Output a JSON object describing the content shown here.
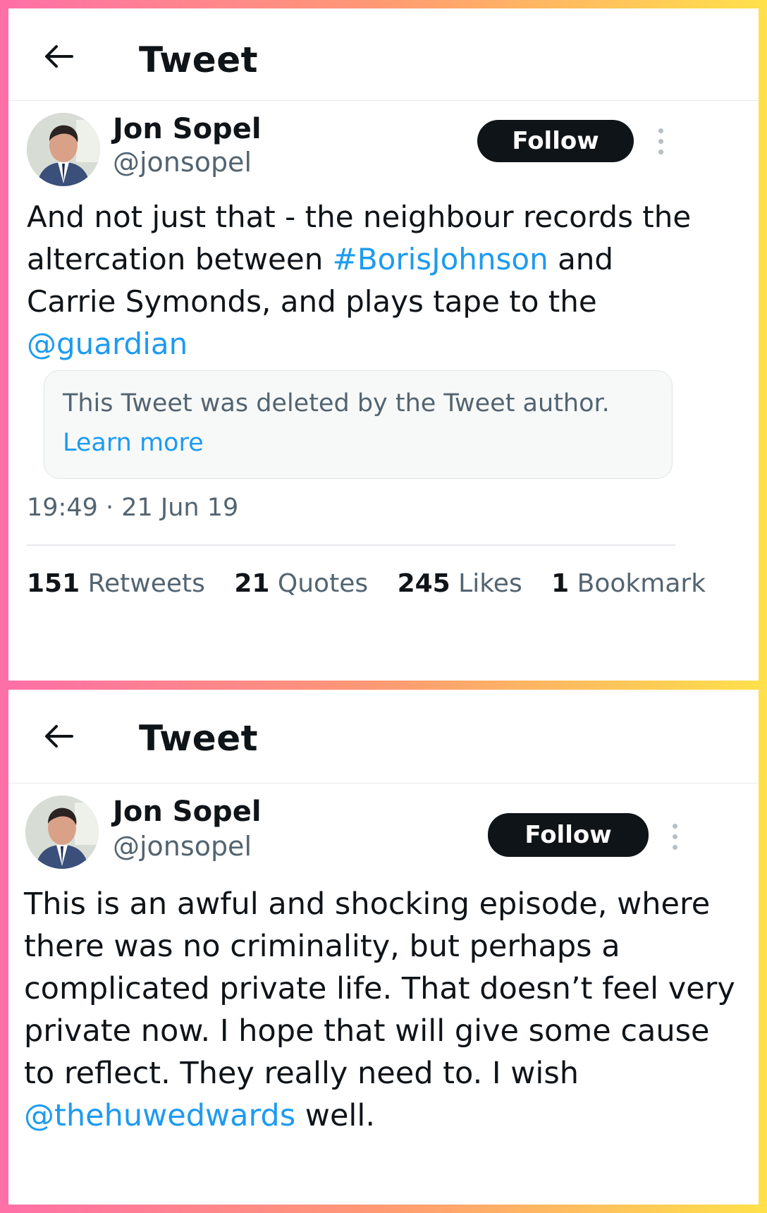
{
  "panels": [
    {
      "header": {
        "title": "Tweet",
        "back_icon": "arrow-left-icon"
      },
      "author": {
        "name": "Jon Sopel",
        "handle": "@jonsopel"
      },
      "follow_label": "Follow",
      "more_icon": "vertical-dots-icon",
      "tweet": {
        "parts": [
          {
            "text": "And not just that - the neighbour records the altercation between ",
            "link": false
          },
          {
            "text": "#BorisJohnson",
            "link": true
          },
          {
            "text": " and Carrie Symonds, and plays tape to the ",
            "link": false
          },
          {
            "text": "@guardian",
            "link": true
          }
        ]
      },
      "quoted": {
        "deleted_text": "This Tweet was deleted by the Tweet author.",
        "learn_more": "Learn more"
      },
      "timestamp": "19:49 · 21 Jun 19",
      "stats": [
        {
          "count": "151",
          "label": "Retweets"
        },
        {
          "count": "21",
          "label": "Quotes"
        },
        {
          "count": "245",
          "label": "Likes"
        },
        {
          "count": "1",
          "label": "Bookmark"
        }
      ]
    },
    {
      "header": {
        "title": "Tweet",
        "back_icon": "arrow-left-icon"
      },
      "author": {
        "name": "Jon Sopel",
        "handle": "@jonsopel"
      },
      "follow_label": "Follow",
      "more_icon": "vertical-dots-icon",
      "tweet": {
        "parts": [
          {
            "text": "This is an awful and shocking episode, where there was no criminality, but perhaps a complicated private life. That doesn’t feel very private now. I hope that will give some cause to reflect. They really need to. I wish ",
            "link": false
          },
          {
            "text": "@thehuwedwards",
            "link": true
          },
          {
            "text": " well.",
            "link": false
          }
        ]
      }
    }
  ],
  "colors": {
    "link": "#1d9bf0",
    "muted": "#536471",
    "button": "#0f1419"
  }
}
